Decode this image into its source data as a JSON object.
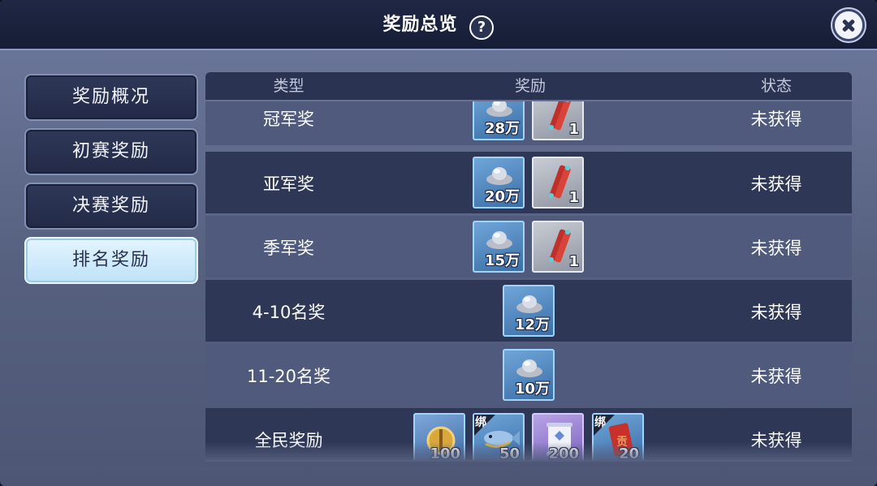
{
  "header": {
    "title": "奖励总览",
    "help_label": "?"
  },
  "sidebar": {
    "tabs": [
      {
        "label": "奖励概况",
        "active": false
      },
      {
        "label": "初赛奖励",
        "active": false
      },
      {
        "label": "决赛奖励",
        "active": false
      },
      {
        "label": "排名奖励",
        "active": true
      }
    ]
  },
  "table": {
    "columns": [
      "类型",
      "奖励",
      "状态"
    ],
    "rows": [
      {
        "type": "冠军奖",
        "status": "未获得",
        "rewards": [
          {
            "icon": "silver-ingot-icon",
            "qty": "28万"
          },
          {
            "icon": "firecracker-bundle-icon",
            "qty": "1"
          }
        ]
      },
      {
        "type": "亚军奖",
        "status": "未获得",
        "rewards": [
          {
            "icon": "silver-ingot-icon",
            "qty": "20万"
          },
          {
            "icon": "firecracker-bundle-icon",
            "qty": "1"
          }
        ]
      },
      {
        "type": "季军奖",
        "status": "未获得",
        "rewards": [
          {
            "icon": "silver-ingot-icon",
            "qty": "15万"
          },
          {
            "icon": "firecracker-bundle-icon",
            "qty": "1"
          }
        ]
      },
      {
        "type": "4-10名奖",
        "status": "未获得",
        "rewards": [
          {
            "icon": "silver-ingot-icon",
            "qty": "12万"
          }
        ]
      },
      {
        "type": "11-20名奖",
        "status": "未获得",
        "rewards": [
          {
            "icon": "silver-ingot-icon",
            "qty": "10万"
          }
        ]
      },
      {
        "type": "全民奖励",
        "status": "未获得",
        "rewards": [
          {
            "icon": "gold-medal-icon",
            "qty": "100"
          },
          {
            "icon": "fish-icon",
            "qty": "50",
            "bound": "绑"
          },
          {
            "icon": "scroll-icon",
            "qty": "200"
          },
          {
            "icon": "red-tag-icon",
            "qty": "20",
            "bound": "绑"
          }
        ]
      }
    ]
  },
  "colors": {
    "accent_active_tab": "#c8e8fb",
    "row_light": "#4f5a7c",
    "row_dark": "#2f3756"
  }
}
